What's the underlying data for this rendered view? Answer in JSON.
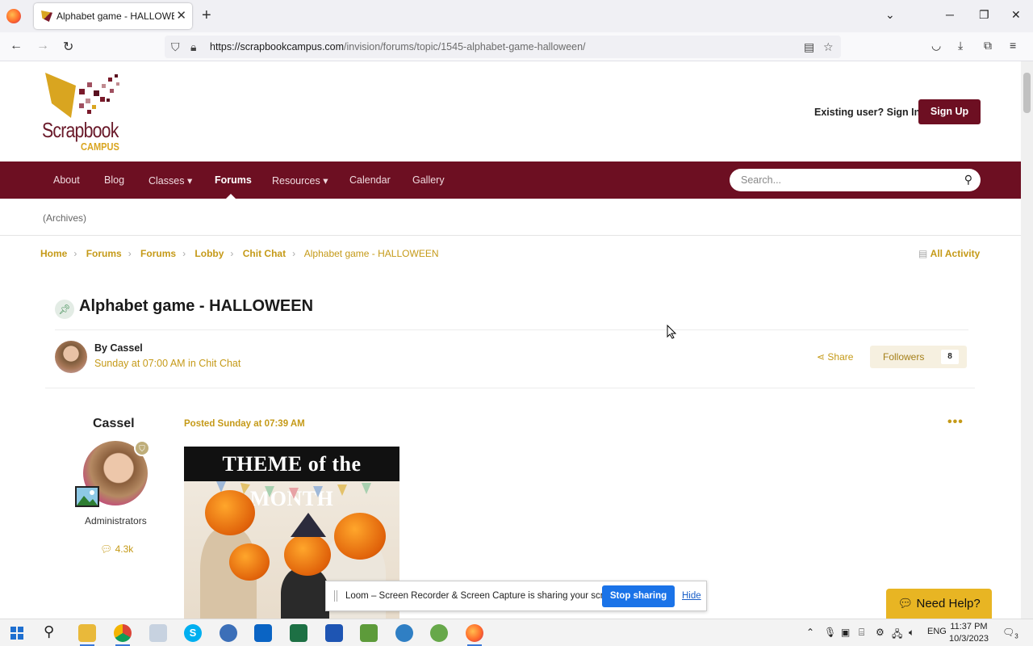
{
  "browser": {
    "tab_title": "Alphabet game - HALLOWEEN",
    "url_domain": "https://scrapbookcampus.com",
    "url_path": "/invision/forums/topic/1545-alphabet-game-halloween/"
  },
  "header": {
    "logo_main": "Scrapbook",
    "logo_sub": "CAMPUS",
    "signin": "Existing user? Sign In",
    "signup": "Sign Up"
  },
  "nav": {
    "items": [
      "About",
      "Blog",
      "Classes",
      "Forums",
      "Resources",
      "Calendar",
      "Gallery"
    ],
    "active": "Forums",
    "search_placeholder": "Search..."
  },
  "subnav": {
    "archives": "(Archives)"
  },
  "breadcrumb": {
    "items": [
      "Home",
      "Forums",
      "Forums",
      "Lobby",
      "Chit Chat",
      "Alphabet game - HALLOWEEN"
    ],
    "all_activity": "All Activity"
  },
  "topic": {
    "title": "Alphabet game - HALLOWEEN",
    "by": "By Cassel",
    "date": "Sunday at 07:00 AM in Chit Chat",
    "share": "Share",
    "followers_label": "Followers",
    "followers_count": "8"
  },
  "post": {
    "author": "Cassel",
    "role": "Administrators",
    "post_count": "4.3k",
    "posted": "Posted Sunday at 07:39 AM",
    "image_banner": "THEME of the MONTH"
  },
  "loom": {
    "message": "Loom – Screen Recorder & Screen Capture is sharing your screen.",
    "stop": "Stop sharing",
    "hide": "Hide"
  },
  "help": {
    "label": "Need Help?"
  },
  "taskbar": {
    "lang": "ENG",
    "time": "11:37 PM",
    "date": "10/3/2023",
    "notif_count": "3"
  },
  "colors": {
    "brand": "#6d0f22",
    "accent": "#c59a18",
    "help": "#e8b523"
  }
}
